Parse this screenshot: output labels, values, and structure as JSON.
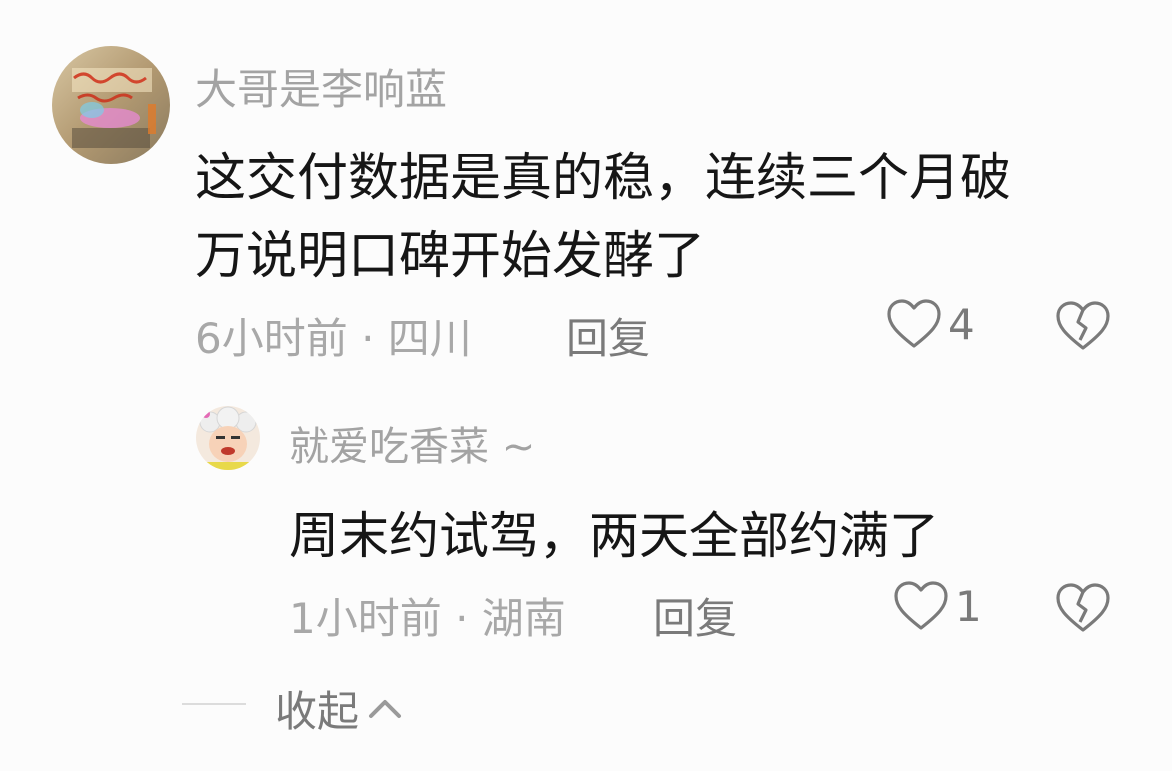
{
  "comments": [
    {
      "author": "大哥是李响蓝",
      "text_line1": "这交付数据是真的稳，连续三个月破",
      "text_line2": "万说明口碑开始发酵了",
      "meta": "6小时前 · 四川",
      "reply_label": "回复",
      "likes": "4"
    }
  ],
  "replies": [
    {
      "author": "就爱吃香菜 ~",
      "text": "周末约试驾，两天全部约满了",
      "meta": "1小时前 · 湖南",
      "reply_label": "回复",
      "likes": "1"
    }
  ],
  "collapse_label": "收起",
  "icons": {
    "like": "heart-outline-icon",
    "dislike": "broken-heart-icon",
    "collapse": "chevron-up-icon"
  },
  "colors": {
    "background": "#fcfcfc",
    "author": "#a3a3a3",
    "text": "#161616",
    "meta": "#a8a8a8"
  }
}
